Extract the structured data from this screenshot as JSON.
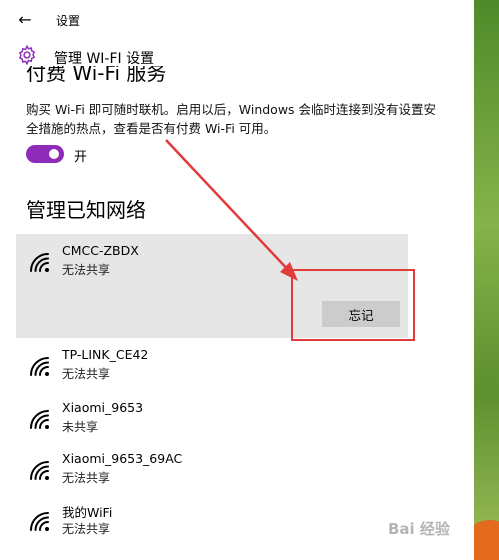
{
  "window": {
    "back_icon": "back-arrow-icon",
    "title": "设置"
  },
  "header": {
    "icon": "gear-icon",
    "title": "管理 WI-FI 设置"
  },
  "paid_wifi": {
    "section_title": "付费 Wi-Fi 服务",
    "description": "购买 Wi-Fi 即可随时联机。启用以后，Windows 会临时连接到没有设置安全措施的热点，查看是否有付费 Wi-Fi 可用。",
    "toggle_state": "on",
    "toggle_label": "开",
    "toggle_color": "#8e2bb8"
  },
  "known_networks": {
    "title": "管理已知网络",
    "forget_label": "忘记",
    "items": [
      {
        "name": "CMCC-ZBDX",
        "status": "无法共享",
        "selected": true
      },
      {
        "name": "TP-LINK_CE42",
        "status": "无法共享",
        "selected": false
      },
      {
        "name": "Xiaomi_9653",
        "status": "未共享",
        "selected": false
      },
      {
        "name": "Xiaomi_9653_69AC",
        "status": "无法共享",
        "selected": false
      },
      {
        "name": "我的WiFi",
        "status": "无法共享",
        "selected": false
      }
    ]
  },
  "annotation": {
    "color": "#e23b3b"
  },
  "watermark": "Bai 经验"
}
